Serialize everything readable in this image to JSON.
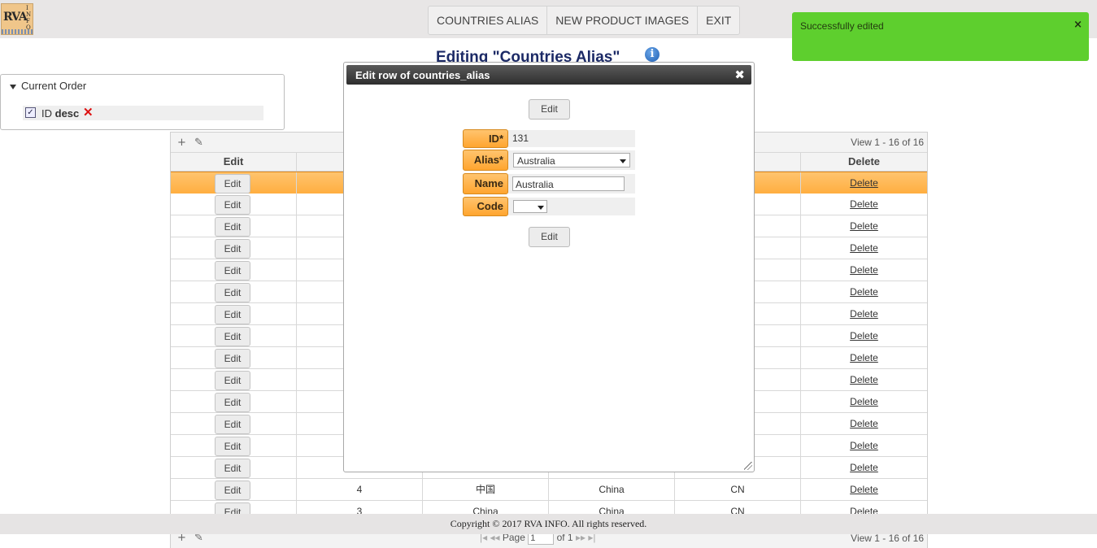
{
  "header": {
    "logo_text": "RVA",
    "logo_subtext": "INFO",
    "nav": [
      "COUNTRIES ALIAS",
      "NEW PRODUCT IMAGES",
      "EXIT"
    ]
  },
  "toast": {
    "message": "Successfully edited",
    "close": "×",
    "color": "#5ecf2e"
  },
  "page": {
    "title": "Editing \"Countries Alias\"",
    "info_icon": "info-icon"
  },
  "current_order": {
    "heading": "Current Order",
    "item_field": "ID",
    "item_direction": "desc",
    "remove_icon": "✕"
  },
  "grid": {
    "toolbar": {
      "add_icon": "+",
      "edit_icon": "✎"
    },
    "view_info": "View 1 - 16 of 16",
    "columns": [
      "Edit",
      "",
      "",
      "",
      "",
      "Delete"
    ],
    "edit_label": "Edit",
    "delete_label": "Delete",
    "rows": [
      {
        "id": "",
        "alias": "",
        "name": "",
        "code": "",
        "selected": true
      },
      {
        "id": "",
        "alias": "",
        "name": "",
        "code": ""
      },
      {
        "id": "",
        "alias": "",
        "name": "",
        "code": ""
      },
      {
        "id": "",
        "alias": "",
        "name": "",
        "code": ""
      },
      {
        "id": "",
        "alias": "",
        "name": "",
        "code": ""
      },
      {
        "id": "",
        "alias": "",
        "name": "",
        "code": ""
      },
      {
        "id": "",
        "alias": "",
        "name": "",
        "code": ""
      },
      {
        "id": "",
        "alias": "",
        "name": "",
        "code": ""
      },
      {
        "id": "",
        "alias": "",
        "name": "",
        "code": ""
      },
      {
        "id": "",
        "alias": "",
        "name": "",
        "code": ""
      },
      {
        "id": "",
        "alias": "",
        "name": "",
        "code": ""
      },
      {
        "id": "",
        "alias": "",
        "name": "",
        "code": ""
      },
      {
        "id": "",
        "alias": "",
        "name": "",
        "code": ""
      },
      {
        "id": "",
        "alias": "",
        "name": "",
        "code": ""
      },
      {
        "id": "4",
        "alias": "中国",
        "name": "China",
        "code": "CN"
      },
      {
        "id": "3",
        "alias": "China",
        "name": "China",
        "code": "CN"
      }
    ],
    "pager": {
      "page_label": "Page",
      "page_value": "1",
      "of_label": "of 1",
      "view_info": "View 1 - 16 of 16"
    }
  },
  "footer": {
    "copyright": "Copyright © 2017 RVA INFO. All rights reserved."
  },
  "modal": {
    "title": "Edit row of countries_alias",
    "close_icon": "✖",
    "top_button": "Edit",
    "bottom_button": "Edit",
    "fields": {
      "id_label": "ID*",
      "id_value": "131",
      "alias_label": "Alias*",
      "alias_value": "Australia",
      "name_label": "Name",
      "name_value": "Australia",
      "code_label": "Code",
      "code_value": ""
    }
  }
}
